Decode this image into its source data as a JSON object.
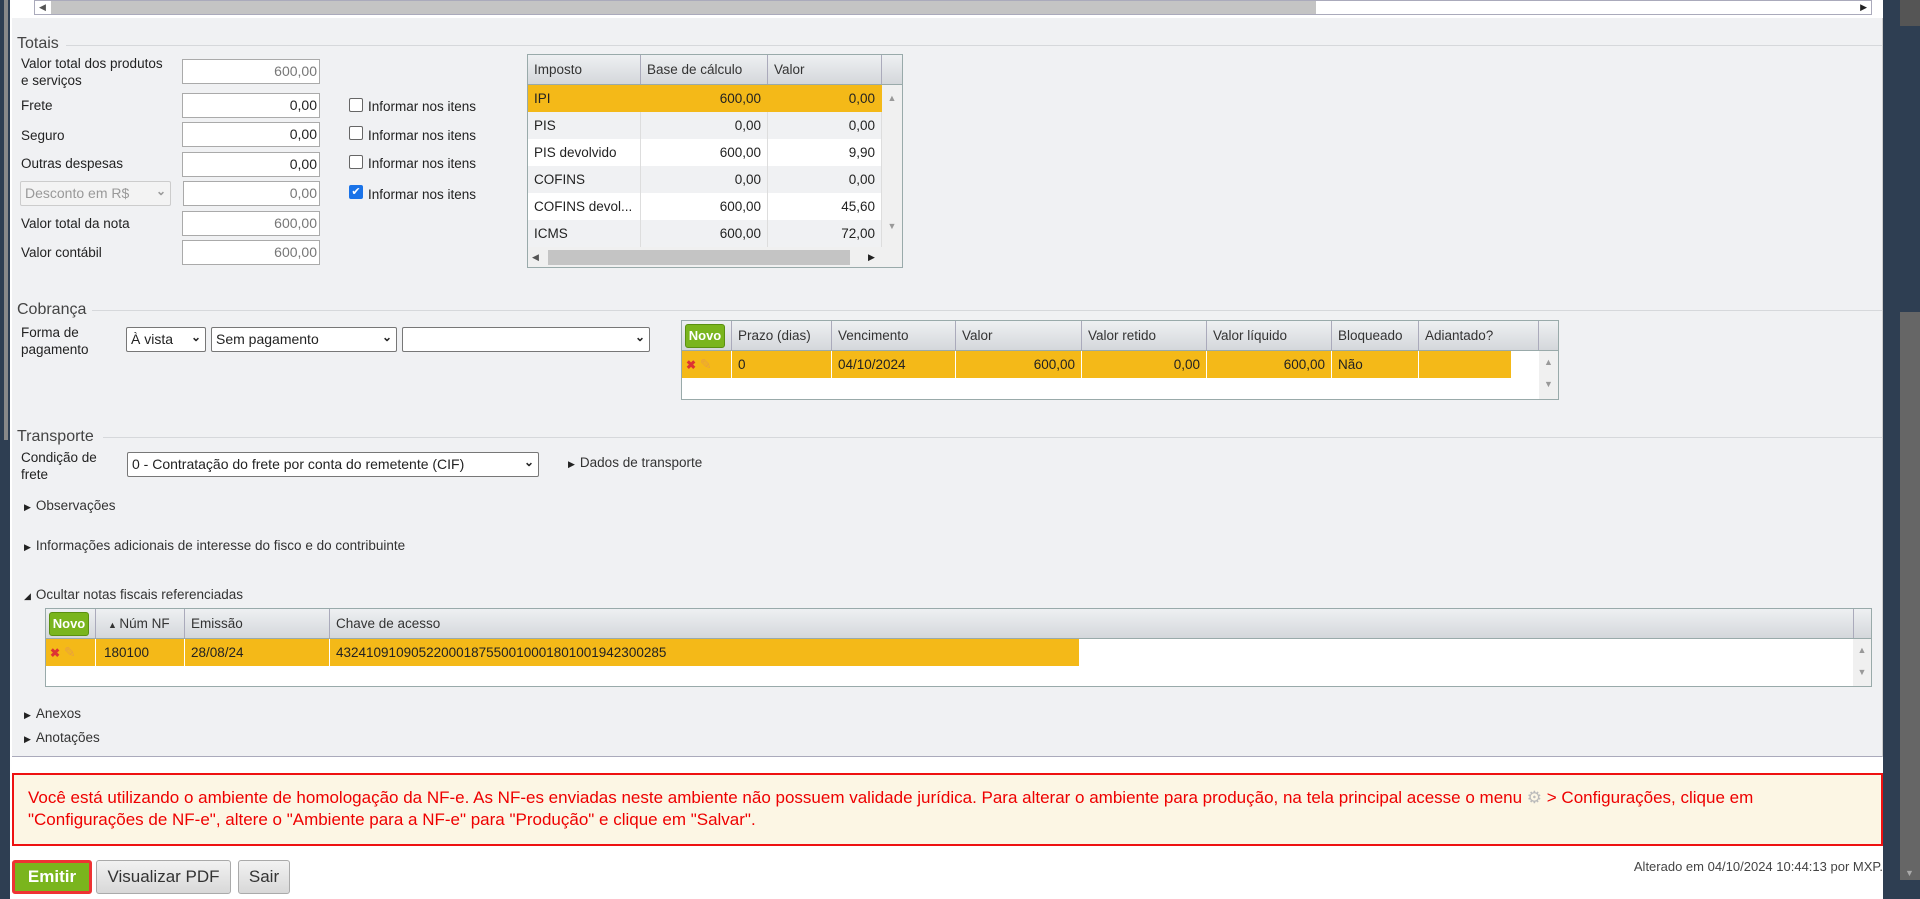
{
  "totais": {
    "legend": "Totais",
    "rows": [
      {
        "label": "Valor total dos produtos e serviços",
        "value": "600,00"
      },
      {
        "label": "Frete",
        "value": "0,00",
        "check_label": "Informar nos itens",
        "checked": false
      },
      {
        "label": "Seguro",
        "value": "0,00",
        "check_label": "Informar nos itens",
        "checked": false
      },
      {
        "label": "Outras despesas",
        "value": "0,00",
        "check_label": "Informar nos itens",
        "checked": false
      },
      {
        "label": "Desconto em R$",
        "value": "0,00",
        "check_label": "Informar nos itens",
        "checked": true
      },
      {
        "label": "Valor total da nota",
        "value": "600,00"
      },
      {
        "label": "Valor contábil",
        "value": "600,00"
      }
    ],
    "tax_table": {
      "headers": [
        "Imposto",
        "Base de cálculo",
        "Valor"
      ],
      "rows": [
        [
          "IPI",
          "600,00",
          "0,00"
        ],
        [
          "PIS",
          "0,00",
          "0,00"
        ],
        [
          "PIS devolvido",
          "600,00",
          "9,90"
        ],
        [
          "COFINS",
          "0,00",
          "0,00"
        ],
        [
          "COFINS devol...",
          "600,00",
          "45,60"
        ],
        [
          "ICMS",
          "600,00",
          "72,00"
        ]
      ]
    }
  },
  "cobranca": {
    "legend": "Cobrança",
    "forma_label": "Forma de pagamento",
    "sel1": "À vista",
    "sel2": "Sem pagamento",
    "sel3": "",
    "novo": "Novo",
    "headers": [
      "Prazo (dias)",
      "Vencimento",
      "Valor",
      "Valor retido",
      "Valor líquido",
      "Bloqueado",
      "Adiantado?"
    ],
    "rows": [
      [
        "0",
        "04/10/2024",
        "600,00",
        "0,00",
        "600,00",
        "Não",
        ""
      ]
    ]
  },
  "transporte": {
    "legend": "Transporte",
    "cond_label": "Condição de frete",
    "cond_value": "0 - Contratação do frete por conta do remetente (CIF)",
    "dados": "Dados de transporte"
  },
  "sections": {
    "obs": "Observações",
    "info": "Informações adicionais de interesse do fisco e do contribuinte",
    "ocultar": "Ocultar notas fiscais referenciadas",
    "anexos": "Anexos",
    "anotacoes": "Anotações"
  },
  "nf_table": {
    "novo": "Novo",
    "headers": [
      "Núm NF",
      "Emissão",
      "Chave de acesso"
    ],
    "rows": [
      [
        "180100",
        "28/08/24",
        "43241091090522000187550010001801001942300285"
      ]
    ]
  },
  "warning": {
    "part1": "Você está utilizando o ambiente de homologação da NF-e. As NF-es enviadas neste ambiente não possuem validade jurídica. Para alterar o ambiente para produção, na tela principal acesse o menu",
    "part2": "> Configurações, clique em \"Configurações de NF-e\", altere o \"Ambiente para a NF-e\" para \"Produção\" e clique em \"Salvar\"."
  },
  "buttons": {
    "emitir": "Emitir",
    "pdf": "Visualizar PDF",
    "sair": "Sair"
  },
  "stamp": "Alterado em 04/10/2024 10:44:13 por MXP.",
  "colors": {
    "highlight": "#f4b918",
    "novo": "#7ab51d",
    "warning": "#e00000"
  }
}
